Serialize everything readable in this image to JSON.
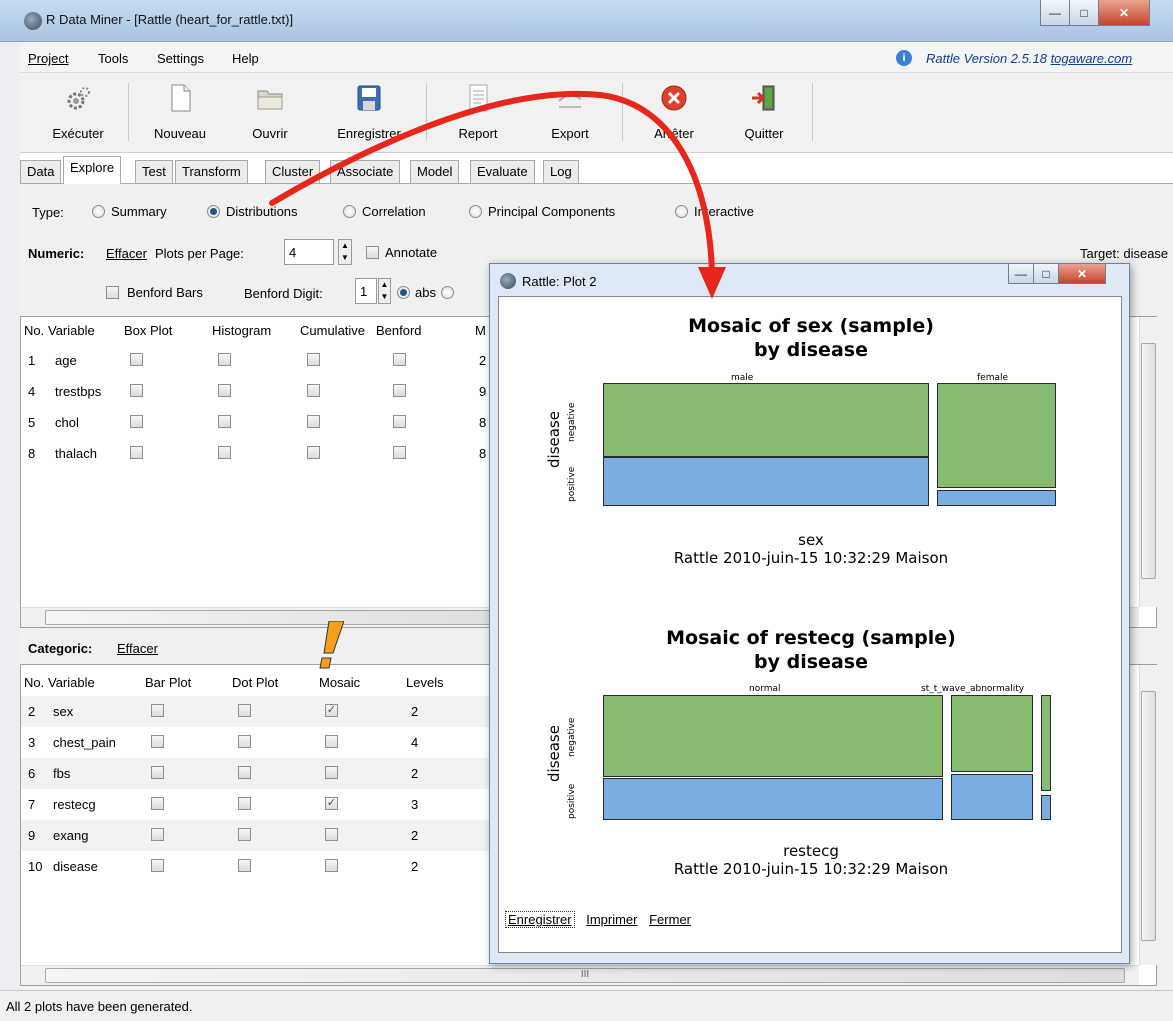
{
  "window": {
    "title": "R Data Miner - [Rattle (heart_for_rattle.txt)]"
  },
  "menu": {
    "items": [
      "Project",
      "Tools",
      "Settings",
      "Help"
    ],
    "version_text": "Rattle Version 2.5.18",
    "version_link": "togaware.com"
  },
  "toolbar": {
    "execute": "Exécuter",
    "new": "Nouveau",
    "open": "Ouvrir",
    "save": "Enregistrer",
    "report": "Report",
    "export": "Export",
    "stop": "Arrêter",
    "quit": "Quitter"
  },
  "tabs": [
    "Data",
    "Explore",
    "Test",
    "Transform",
    "Cluster",
    "Associate",
    "Model",
    "Evaluate",
    "Log"
  ],
  "explore": {
    "type_label": "Type:",
    "types": [
      "Summary",
      "Distributions",
      "Correlation",
      "Principal Components",
      "Interactive"
    ],
    "selected_type": "Distributions",
    "numeric_label": "Numeric:",
    "clear": "Effacer",
    "plots_per_page_label": "Plots per Page:",
    "plots_per_page": "4",
    "annotate": "Annotate",
    "target": "Target: disease",
    "benford_bars": "Benford Bars",
    "benford_digit_label": "Benford Digit:",
    "benford_digit": "1",
    "abs": "abs"
  },
  "numeric_table": {
    "headers": [
      "No.",
      "Variable",
      "Box Plot",
      "Histogram",
      "Cumulative",
      "Benford",
      "M"
    ],
    "rows": [
      {
        "no": "1",
        "var": "age",
        "min": "2"
      },
      {
        "no": "4",
        "var": "trestbps",
        "min": "9"
      },
      {
        "no": "5",
        "var": "chol",
        "min": "8"
      },
      {
        "no": "8",
        "var": "thalach",
        "min": "8"
      }
    ]
  },
  "categoric": {
    "label": "Categoric:",
    "clear": "Effacer",
    "headers": [
      "No.",
      "Variable",
      "Bar Plot",
      "Dot Plot",
      "Mosaic",
      "Levels"
    ],
    "rows": [
      {
        "no": "2",
        "var": "sex",
        "mosaic": true,
        "levels": "2"
      },
      {
        "no": "3",
        "var": "chest_pain",
        "mosaic": false,
        "levels": "4"
      },
      {
        "no": "6",
        "var": "fbs",
        "mosaic": false,
        "levels": "2"
      },
      {
        "no": "7",
        "var": "restecg",
        "mosaic": true,
        "levels": "3"
      },
      {
        "no": "9",
        "var": "exang",
        "mosaic": false,
        "levels": "2"
      },
      {
        "no": "10",
        "var": "disease",
        "mosaic": false,
        "levels": "2"
      }
    ]
  },
  "status": "All 2 plots have been generated.",
  "plot_window": {
    "title": "Rattle: Plot 2",
    "buttons": [
      "Enregistrer",
      "Imprimer",
      "Fermer"
    ],
    "plot1": {
      "title1": "Mosaic of sex  (sample)",
      "title2": "by disease",
      "ylabel": "disease",
      "levels_y": [
        "negative",
        "positive"
      ],
      "cols": [
        "male",
        "female"
      ],
      "xlabel": "sex",
      "caption": "Rattle 2010-juin-15 10:32:29 Maison"
    },
    "plot2": {
      "title1": "Mosaic of restecg  (sample)",
      "title2": "by disease",
      "ylabel": "disease",
      "levels_y": [
        "negative",
        "positive"
      ],
      "cols": [
        "normal",
        "st_t_wave_abnormality"
      ],
      "xlabel": "restecg",
      "caption": "Rattle 2010-juin-15 10:32:29 Maison"
    }
  },
  "scroll_grip": "III",
  "colors": {
    "green": "#88bb72",
    "blue": "#7aaee0",
    "arrow": "#e8261b",
    "warn": "#f5a01a"
  }
}
